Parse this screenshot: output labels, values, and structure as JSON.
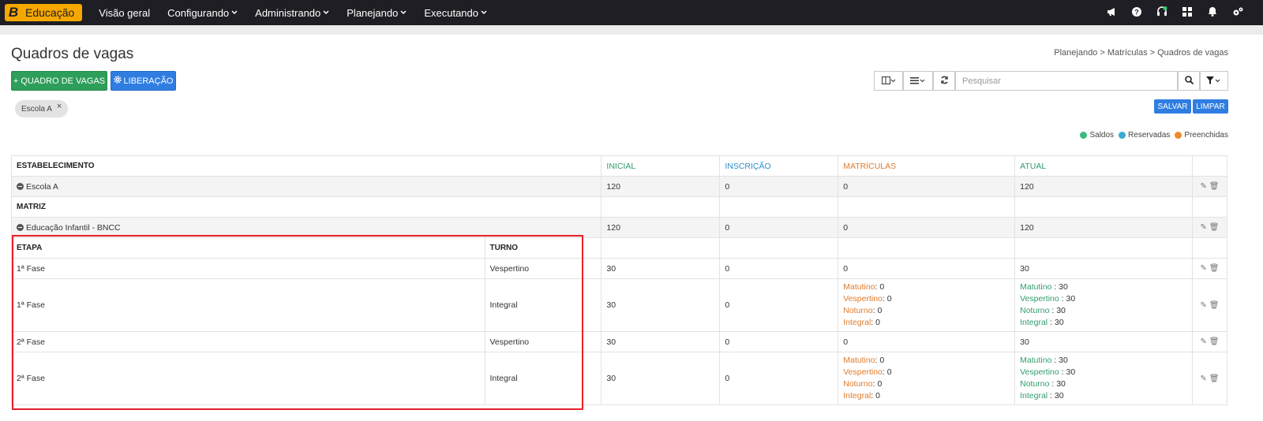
{
  "app": {
    "logo_letter": "B",
    "logo_text": "Educação"
  },
  "nav": [
    {
      "label": "Visão geral",
      "caret": false
    },
    {
      "label": "Configurando",
      "caret": true
    },
    {
      "label": "Administrando",
      "caret": true
    },
    {
      "label": "Planejando",
      "caret": true
    },
    {
      "label": "Executando",
      "caret": true
    }
  ],
  "top_icons": [
    "megaphone-icon",
    "help-icon",
    "headset-icon",
    "apps-grid-icon",
    "bell-icon",
    "settings-cogs-icon"
  ],
  "page": {
    "title": "Quadros de vagas",
    "breadcrumb": "Planejando > Matrículas > Quadros de vagas"
  },
  "buttons": {
    "add": "+ QUADRO DE VAGAS",
    "release": "LIBERAÇÃO",
    "save": "SALVAR",
    "clear": "LIMPAR"
  },
  "search": {
    "placeholder": "Pesquisar"
  },
  "filter_chip": {
    "label": "Escola A"
  },
  "legend": [
    {
      "label": "Saldos",
      "color": "#3dba7e"
    },
    {
      "label": "Reservadas",
      "color": "#3aa9d6"
    },
    {
      "label": "Preenchidas",
      "color": "#ef8a2b"
    }
  ],
  "table": {
    "headers": {
      "estab": "ESTABELECIMENTO",
      "inicial": "INICIAL",
      "inscricao": "INSCRIÇÃO",
      "matriculas": "MATRÍCULAS",
      "atual": "ATUAL"
    },
    "school": {
      "name": "Escola A",
      "inicial": "120",
      "inscricao": "0",
      "matriculas": "0",
      "atual": "120"
    },
    "matriz_header": "MATRIZ",
    "matriz": {
      "name": "Educação Infantil - BNCC",
      "inicial": "120",
      "inscricao": "0",
      "matriculas": "0",
      "atual": "120"
    },
    "etapa_headers": {
      "etapa": "ETAPA",
      "turno": "TURNO"
    },
    "rows": [
      {
        "etapa": "1ª Fase",
        "turno": "Vespertino",
        "inicial": "30",
        "inscricao": "0",
        "matriculas": "0",
        "atual": "30"
      },
      {
        "etapa": "1ª Fase",
        "turno": "Integral",
        "inicial": "30",
        "inscricao": "0",
        "mat_lines": [
          [
            "Matutino",
            ": 0"
          ],
          [
            "Vespertino",
            ": 0"
          ],
          [
            "Noturno",
            ": 0"
          ],
          [
            "Integral",
            ": 0"
          ]
        ],
        "atual_lines": [
          [
            "Matutino",
            " : 30"
          ],
          [
            "Vespertino",
            " : 30"
          ],
          [
            "Noturno",
            " : 30"
          ],
          [
            "Integral",
            " : 30"
          ]
        ]
      },
      {
        "etapa": "2ª Fase",
        "turno": "Vespertino",
        "inicial": "30",
        "inscricao": "0",
        "matriculas": "0",
        "atual": "30"
      },
      {
        "etapa": "2ª Fase",
        "turno": "Integral",
        "inicial": "30",
        "inscricao": "0",
        "mat_lines": [
          [
            "Matutino",
            ": 0"
          ],
          [
            "Vespertino",
            ": 0"
          ],
          [
            "Noturno",
            ": 0"
          ],
          [
            "Integral",
            ": 0"
          ]
        ],
        "atual_lines": [
          [
            "Matutino",
            " : 30"
          ],
          [
            "Vespertino",
            " : 30"
          ],
          [
            "Noturno",
            " : 30"
          ],
          [
            "Integral",
            " : 30"
          ]
        ]
      }
    ]
  }
}
